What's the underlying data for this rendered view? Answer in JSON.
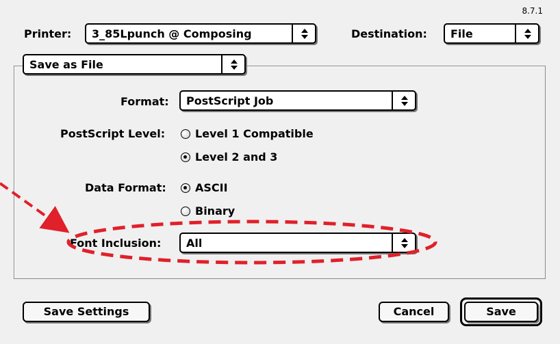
{
  "version": "8.7.1",
  "printer": {
    "label": "Printer:",
    "value": "3_85Lpunch @ Composing"
  },
  "destination": {
    "label": "Destination:",
    "value": "File"
  },
  "panel": {
    "value": "Save as File"
  },
  "format": {
    "label": "Format:",
    "value": "PostScript Job"
  },
  "postscript_level": {
    "label": "PostScript Level:",
    "options": [
      {
        "label": "Level 1 Compatible",
        "selected": false
      },
      {
        "label": "Level 2 and 3",
        "selected": true
      }
    ]
  },
  "data_format": {
    "label": "Data Format:",
    "options": [
      {
        "label": "ASCII",
        "selected": true
      },
      {
        "label": "Binary",
        "selected": false
      }
    ]
  },
  "font_inclusion": {
    "label": "Font Inclusion:",
    "value": "All"
  },
  "buttons": {
    "save_settings": "Save Settings",
    "cancel": "Cancel",
    "save": "Save"
  },
  "annotation": {
    "color": "#e0202a"
  }
}
